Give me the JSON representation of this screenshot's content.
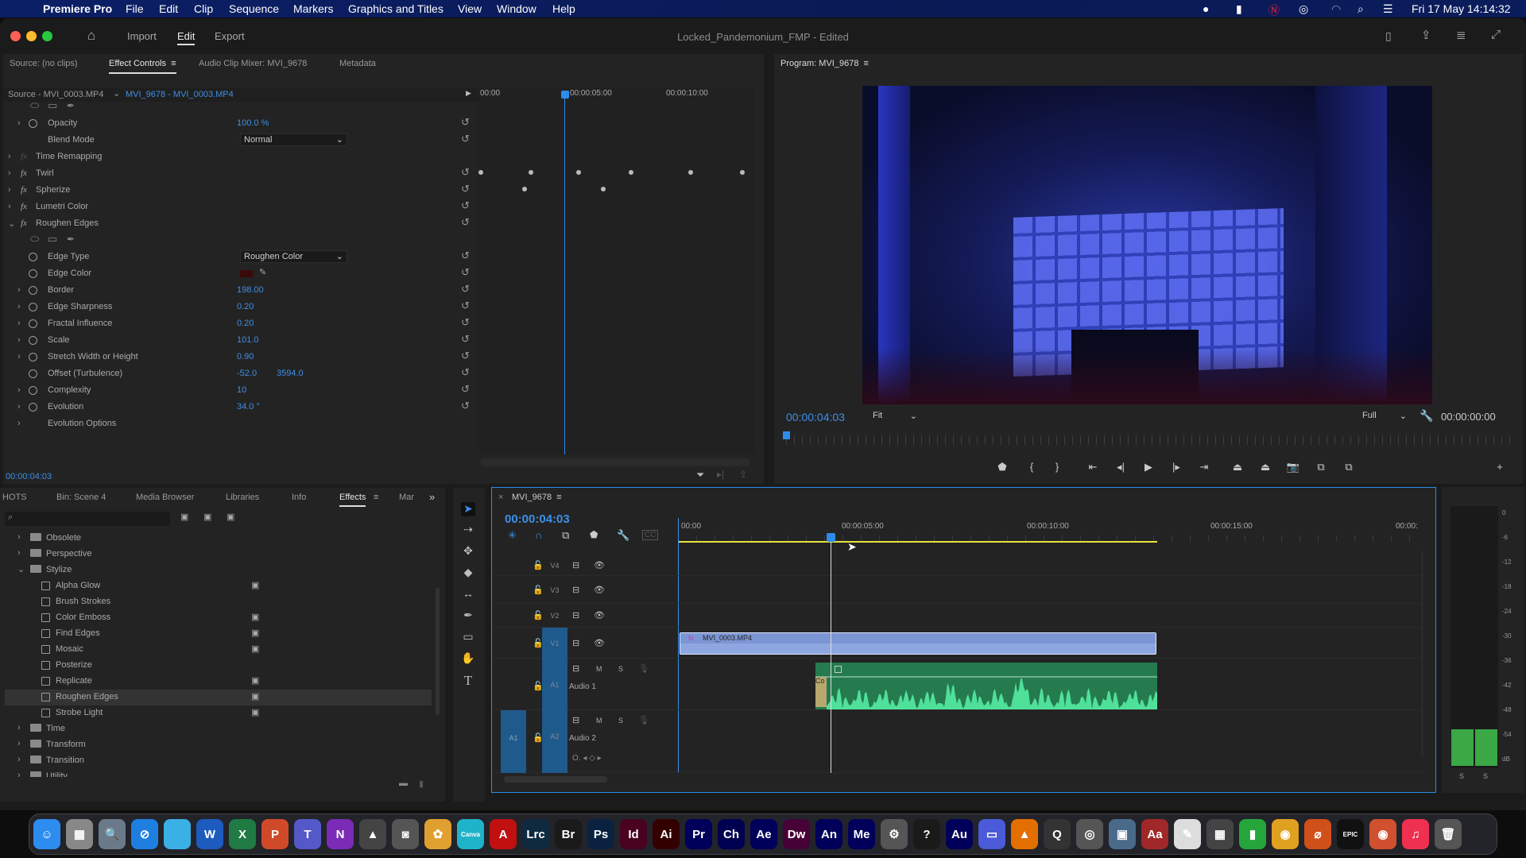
{
  "menubar": {
    "app_name": "Premiere Pro",
    "items": [
      "File",
      "Edit",
      "Clip",
      "Sequence",
      "Markers",
      "Graphics and Titles",
      "View",
      "Window",
      "Help"
    ],
    "clock": "Fri 17 May  14:14:32"
  },
  "titlebar": {
    "workspaces": [
      "Import",
      "Edit",
      "Export"
    ],
    "active_workspace": "Edit",
    "title": "Locked_Pandemonium_FMP - Edited"
  },
  "effect_panel": {
    "tabs": [
      "Source: (no clips)",
      "Effect Controls",
      "Audio Clip Mixer: MVI_9678",
      "Metadata"
    ],
    "source_label": "Source - MVI_0003.MP4",
    "clip_label": "MVI_9678 - MVI_0003.MP4",
    "ruler": [
      "00:00",
      "00:00:05:00",
      "00:00:10:00"
    ],
    "timecode": "00:00:04:03",
    "rows": [
      {
        "type": "icons"
      },
      {
        "type": "prop",
        "label": "Opacity",
        "value": "100.0 %",
        "chev": true,
        "sw": true,
        "reset": true
      },
      {
        "type": "prop",
        "label": "Blend Mode",
        "dropdown": "Normal",
        "reset": true
      },
      {
        "type": "fx",
        "label": "Time Remapping",
        "dim": true
      },
      {
        "type": "fx",
        "label": "Twirl",
        "reset": true
      },
      {
        "type": "fx",
        "label": "Spherize",
        "reset": true
      },
      {
        "type": "fx",
        "label": "Lumetri Color",
        "reset": true
      },
      {
        "type": "fx",
        "label": "Roughen Edges",
        "open": true,
        "reset": true
      },
      {
        "type": "icons"
      },
      {
        "type": "prop",
        "label": "Edge Type",
        "dropdown": "Roughen Color",
        "sw": true,
        "reset": true
      },
      {
        "type": "prop",
        "label": "Edge Color",
        "swatch": "#3a0a0a",
        "sw": true,
        "reset": true
      },
      {
        "type": "prop",
        "label": "Border",
        "value": "198.00",
        "chev": true,
        "sw": true,
        "reset": true
      },
      {
        "type": "prop",
        "label": "Edge Sharpness",
        "value": "0.20",
        "chev": true,
        "sw": true,
        "reset": true
      },
      {
        "type": "prop",
        "label": "Fractal Influence",
        "value": "0.20",
        "chev": true,
        "sw": true,
        "reset": true
      },
      {
        "type": "prop",
        "label": "Scale",
        "value": "101.0",
        "chev": true,
        "sw": true,
        "reset": true
      },
      {
        "type": "prop",
        "label": "Stretch Width or Height",
        "value": "0.90",
        "chev": true,
        "sw": true,
        "reset": true
      },
      {
        "type": "prop",
        "label": "Offset (Turbulence)",
        "value": "-52.0",
        "value2": "3594.0",
        "sw": true,
        "reset": true
      },
      {
        "type": "prop",
        "label": "Complexity",
        "value": "10",
        "chev": true,
        "sw": true,
        "reset": true
      },
      {
        "type": "prop",
        "label": "Evolution",
        "value": "34.0 °",
        "chev": true,
        "sw": true,
        "reset": true
      },
      {
        "type": "prop",
        "label": "Evolution Options",
        "chev": true
      }
    ]
  },
  "program": {
    "title": "Program: MVI_9678",
    "timecode": "00:00:04:03",
    "fit": "Fit",
    "quality": "Full",
    "duration": "00:00:00:00",
    "transport": [
      "marker-icon",
      "mark-in-icon",
      "mark-out-icon",
      "go-to-in-icon",
      "step-back-icon",
      "play-icon",
      "step-forward-icon",
      "go-to-out-icon",
      "lift-icon",
      "extract-icon",
      "export-frame-icon",
      "insert-icon",
      "overwrite-icon",
      "add-button-icon"
    ]
  },
  "project_panel": {
    "tabs": [
      "HOTS",
      "Bin: Scene 4",
      "Media Browser",
      "Libraries",
      "Info",
      "Effects",
      "Mar"
    ],
    "active_tab": "Effects",
    "tree": [
      {
        "label": "Obsolete",
        "folder": true
      },
      {
        "label": "Perspective",
        "folder": true
      },
      {
        "label": "Stylize",
        "folder": true,
        "open": true
      },
      {
        "label": "Alpha Glow",
        "badge": true
      },
      {
        "label": "Brush Strokes"
      },
      {
        "label": "Color Emboss",
        "badge": true
      },
      {
        "label": "Find Edges",
        "badge": true
      },
      {
        "label": "Mosaic",
        "badge": true
      },
      {
        "label": "Posterize"
      },
      {
        "label": "Replicate",
        "badge": true
      },
      {
        "label": "Roughen Edges",
        "badge": true,
        "selected": true
      },
      {
        "label": "Strobe Light",
        "badge": true
      },
      {
        "label": "Time",
        "folder": true
      },
      {
        "label": "Transform",
        "folder": true
      },
      {
        "label": "Transition",
        "folder": true
      },
      {
        "label": "Utility",
        "folder": true
      }
    ]
  },
  "timeline": {
    "sequence": "MVI_9678",
    "timecode": "00:00:04:03",
    "ruler": [
      "00:00",
      "00:00:05:00",
      "00:00:10:00",
      "00:00:15:00",
      "00:00:"
    ],
    "tracks": [
      {
        "id": "V4",
        "kind": "video"
      },
      {
        "id": "V3",
        "kind": "video"
      },
      {
        "id": "V2",
        "kind": "video"
      },
      {
        "id": "V1",
        "kind": "video",
        "target": true
      },
      {
        "id": "A1",
        "kind": "audio",
        "name": "Audio 1",
        "target": true
      },
      {
        "id": "A2",
        "kind": "audio",
        "name": "Audio 2",
        "source": "A1"
      }
    ],
    "video_clip": "MVI_0003.MP4",
    "audio_clip_label": "Co",
    "audio_mute": "M",
    "audio_solo": "S"
  },
  "meter": {
    "scale": [
      "0",
      "-6",
      "-12",
      "-18",
      "-24",
      "-30",
      "-36",
      "-42",
      "-48",
      "-54",
      "dB"
    ],
    "solo": [
      "S",
      "S"
    ]
  },
  "dock": [
    {
      "name": "Finder",
      "t": "☺",
      "c": "#2d8cf0"
    },
    {
      "name": "Launchpad",
      "t": "▦",
      "c": "#888"
    },
    {
      "name": "Preview",
      "t": "🔍",
      "c": "#6a7a8a"
    },
    {
      "name": "Safari",
      "t": "⊘",
      "c": "#1e7fe0"
    },
    {
      "name": "Mirror",
      "t": "",
      "c": "#3ab0e6"
    },
    {
      "name": "Word",
      "t": "W",
      "c": "#1d5bbf"
    },
    {
      "name": "Excel",
      "t": "X",
      "c": "#1f7a44"
    },
    {
      "name": "PowerPoint",
      "t": "P",
      "c": "#d04a2a"
    },
    {
      "name": "Teams",
      "t": "T",
      "c": "#5558c8"
    },
    {
      "name": "OneNote",
      "t": "N",
      "c": "#7b2bb5"
    },
    {
      "name": "Resolve",
      "t": "▲",
      "c": "#444"
    },
    {
      "name": "Photo Booth",
      "t": "◙",
      "c": "#555"
    },
    {
      "name": "Photos",
      "t": "✿",
      "c": "#e0a030"
    },
    {
      "name": "Canva",
      "t": "Canva",
      "c": "#1fb3c9"
    },
    {
      "name": "Acrobat",
      "t": "A",
      "c": "#c01010"
    },
    {
      "name": "Lightroom Classic",
      "t": "Lrc",
      "c": "#0f2a3f"
    },
    {
      "name": "Bridge",
      "t": "Br",
      "c": "#1a1a1a"
    },
    {
      "name": "Photoshop",
      "t": "Ps",
      "c": "#0a2240"
    },
    {
      "name": "InDesign",
      "t": "Id",
      "c": "#49021f"
    },
    {
      "name": "Illustrator",
      "t": "Ai",
      "c": "#330000"
    },
    {
      "name": "Premiere Pro",
      "t": "Pr",
      "c": "#00005b"
    },
    {
      "name": "Character Animator",
      "t": "Ch",
      "c": "#000051"
    },
    {
      "name": "After Effects",
      "t": "Ae",
      "c": "#00005b"
    },
    {
      "name": "Dreamweaver",
      "t": "Dw",
      "c": "#470137"
    },
    {
      "name": "Animate",
      "t": "An",
      "c": "#00005b"
    },
    {
      "name": "Media Encoder",
      "t": "Me",
      "c": "#00005b"
    },
    {
      "name": "Disk Utility",
      "t": "⚙",
      "c": "#555"
    },
    {
      "name": "Help",
      "t": "?",
      "c": "#1a1a1a"
    },
    {
      "name": "Audition",
      "t": "Au",
      "c": "#00005b"
    },
    {
      "name": "Screen Sharing",
      "t": "▭",
      "c": "#4a5ad8"
    },
    {
      "name": "VLC",
      "t": "▲",
      "c": "#e36f00"
    },
    {
      "name": "QuickTime",
      "t": "Q",
      "c": "#333"
    },
    {
      "name": "Screenshot",
      "t": "◎",
      "c": "#555"
    },
    {
      "name": "Image Capture",
      "t": "▣",
      "c": "#4a6a8a"
    },
    {
      "name": "Dictionary",
      "t": "Aa",
      "c": "#a02828"
    },
    {
      "name": "TextEdit",
      "t": "✎",
      "c": "#ddd"
    },
    {
      "name": "Calculator",
      "t": "▦",
      "c": "#444"
    },
    {
      "name": "Numbers",
      "t": "▮",
      "c": "#25a63a"
    },
    {
      "name": "Chrome",
      "t": "◉",
      "c": "#e0a020"
    },
    {
      "name": "Harmony",
      "t": "⌀",
      "c": "#d0501a"
    },
    {
      "name": "Epic Games",
      "t": "EPIC",
      "c": "#111"
    },
    {
      "name": "Chrome 2",
      "t": "◉",
      "c": "#d05030"
    },
    {
      "name": "Music",
      "t": "♫",
      "c": "#f03050"
    },
    {
      "name": "Trash",
      "t": "🗑",
      "c": "#555"
    }
  ]
}
